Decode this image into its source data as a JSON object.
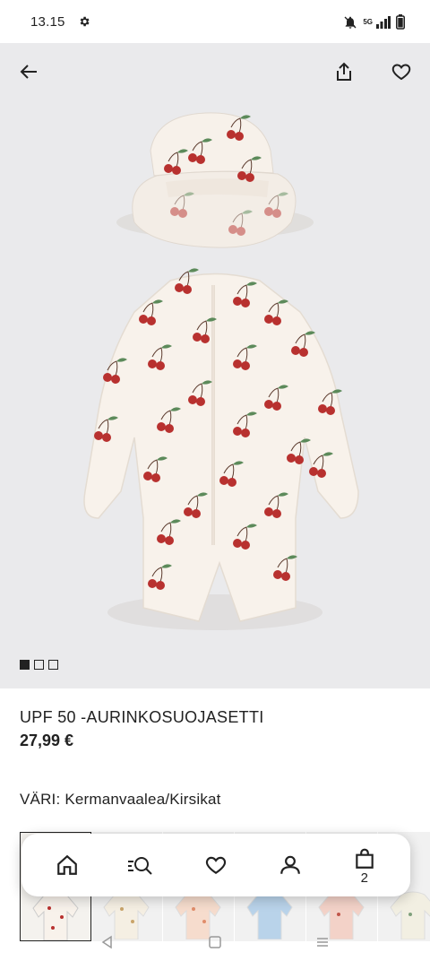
{
  "status_bar": {
    "time": "13.15",
    "network": "5G"
  },
  "product": {
    "title": "UPF 50 -AURINKOSUOJASETTI",
    "price": "27,99 €",
    "color_label": "VÄRI: Kermanvaalea/Kirsikat"
  },
  "gallery": {
    "image_count": 3,
    "active_index": 0
  },
  "bottom_nav": {
    "bag_count": "2"
  },
  "thumbnails": [
    {
      "variant": "cream-cherries",
      "selected": true
    },
    {
      "variant": "cream-pattern-1",
      "selected": false
    },
    {
      "variant": "peach-pattern",
      "selected": false
    },
    {
      "variant": "light-blue",
      "selected": false
    },
    {
      "variant": "pink-pattern",
      "selected": false
    },
    {
      "variant": "cream-pattern-2",
      "selected": false
    }
  ],
  "colors": {
    "cherry_red": "#b8312f",
    "leaf_green": "#5c8a5a",
    "fabric_cream": "#f7f1ea",
    "background_gray": "#eaeaec"
  }
}
